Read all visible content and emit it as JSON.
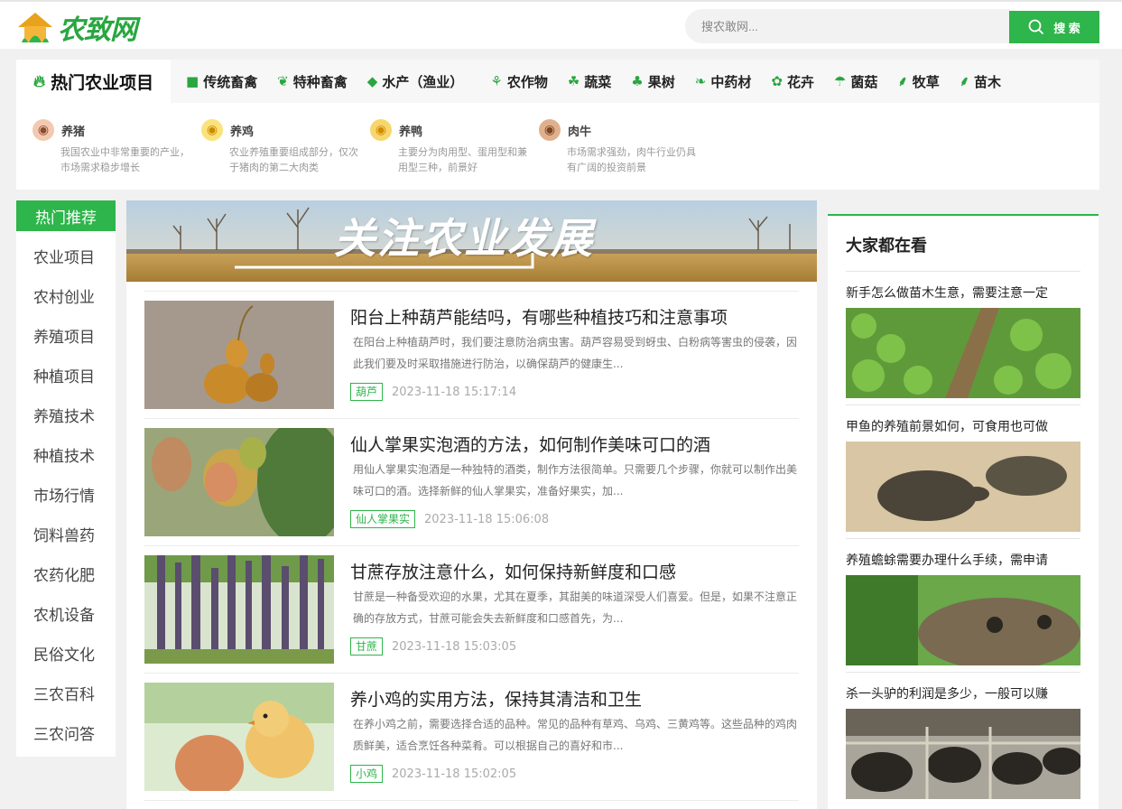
{
  "site": {
    "logo_text": "农致网"
  },
  "search": {
    "placeholder": "搜农敢网...",
    "button_label": "搜 索"
  },
  "nav": {
    "first": "热门农业项目",
    "items": [
      "传统畜禽",
      "特种畜禽",
      "水产（渔业）",
      "农作物",
      "蔬菜",
      "果树",
      "中药材",
      "花卉",
      "菌菇",
      "牧草",
      "苗木"
    ],
    "subs": [
      {
        "title": "养猪",
        "desc": "我国农业中非常重要的产业，市场需求稳步增长"
      },
      {
        "title": "养鸡",
        "desc": "农业养殖重要组成部分，仅次于猪肉的第二大肉类"
      },
      {
        "title": "养鸭",
        "desc": "主要分为肉用型、蛋用型和兼用型三种，前景好"
      },
      {
        "title": "肉牛",
        "desc": "市场需求强劲，肉牛行业仍具有广阔的投资前景"
      }
    ]
  },
  "sidebar": {
    "head": "热门推荐",
    "items": [
      "农业项目",
      "农村创业",
      "养殖项目",
      "种植项目",
      "养殖技术",
      "种植技术",
      "市场行情",
      "饲料兽药",
      "农药化肥",
      "农机设备",
      "民俗文化",
      "三农百科",
      "三农问答"
    ]
  },
  "banner": {
    "title": "关注农业发展"
  },
  "articles": [
    {
      "title": "阳台上种葫芦能结吗，有哪些种植技巧和注意事项",
      "summary": "在阳台上种植葫芦时，我们要注意防治病虫害。葫芦容易受到蚜虫、白粉病等害虫的侵袭，因此我们要及时采取措施进行防治，以确保葫芦的健康生...",
      "tag": "葫芦",
      "date": "2023-11-18 15:17:14"
    },
    {
      "title": "仙人掌果实泡酒的方法，如何制作美味可口的酒",
      "summary": "用仙人掌果实泡酒是一种独特的酒类，制作方法很简单。只需要几个步骤，你就可以制作出美味可口的酒。选择新鲜的仙人掌果实，准备好果实，加...",
      "tag": "仙人掌果实",
      "date": "2023-11-18 15:06:08"
    },
    {
      "title": "甘蔗存放注意什么，如何保持新鲜度和口感",
      "summary": "甘蔗是一种备受欢迎的水果，尤其在夏季，其甜美的味道深受人们喜爱。但是，如果不注意正确的存放方式，甘蔗可能会失去新鲜度和口感首先，为...",
      "tag": "甘蔗",
      "date": "2023-11-18 15:03:05"
    },
    {
      "title": "养小鸡的实用方法，保持其清洁和卫生",
      "summary": "在养小鸡之前，需要选择合适的品种。常见的品种有草鸡、乌鸡、三黄鸡等。这些品种的鸡肉质鲜美，适合烹饪各种菜肴。可以根据自己的喜好和市...",
      "tag": "小鸡",
      "date": "2023-11-18 15:02:05"
    }
  ],
  "right": {
    "title": "大家都在看",
    "items": [
      {
        "title": "新手怎么做苗木生意，需要注意一定"
      },
      {
        "title": "甲鱼的养殖前景如何，可食用也可做"
      },
      {
        "title": "养殖蟾蜍需要办理什么手续，需申请"
      },
      {
        "title": "杀一头驴的利润是多少，一般可以赚"
      }
    ]
  },
  "colors": {
    "accent": "#2eb54b",
    "text": "#333333",
    "muted": "#999999"
  }
}
